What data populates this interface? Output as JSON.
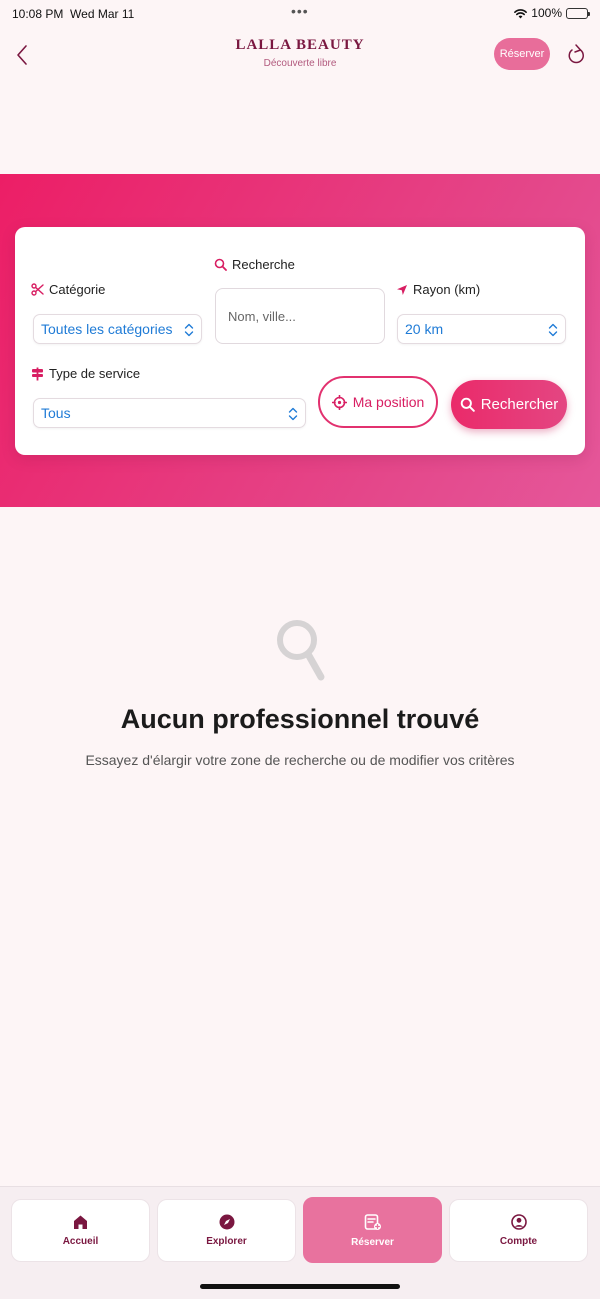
{
  "status_bar": {
    "time": "10:08 PM",
    "date": "Wed Mar 11",
    "battery": "100%"
  },
  "header": {
    "title": "LALLA BEAUTY",
    "subtitle": "Découverte libre",
    "reserve_label": "Réserver"
  },
  "filters": {
    "category": {
      "label": "Catégorie",
      "value": "Toutes les catégories"
    },
    "search": {
      "label": "Recherche",
      "placeholder": "Nom, ville..."
    },
    "radius": {
      "label": "Rayon (km)",
      "value": "20 km"
    },
    "service_type": {
      "label": "Type de service",
      "value": "Tous"
    },
    "position_label": "Ma position",
    "search_button_label": "Rechercher"
  },
  "empty_state": {
    "title": "Aucun professionnel trouvé",
    "message": "Essayez d'élargir votre zone de recherche ou de modifier vos critères"
  },
  "tabs": [
    {
      "label": "Accueil",
      "icon": "home-icon",
      "active": false
    },
    {
      "label": "Explorer",
      "icon": "compass-icon",
      "active": false
    },
    {
      "label": "Réserver",
      "icon": "booking-icon",
      "active": true
    },
    {
      "label": "Compte",
      "icon": "account-icon",
      "active": false
    }
  ],
  "colors": {
    "brand": "#7a1740",
    "accent": "#e8729e",
    "hero": "#ec1e66",
    "link": "#1f7bd6"
  }
}
